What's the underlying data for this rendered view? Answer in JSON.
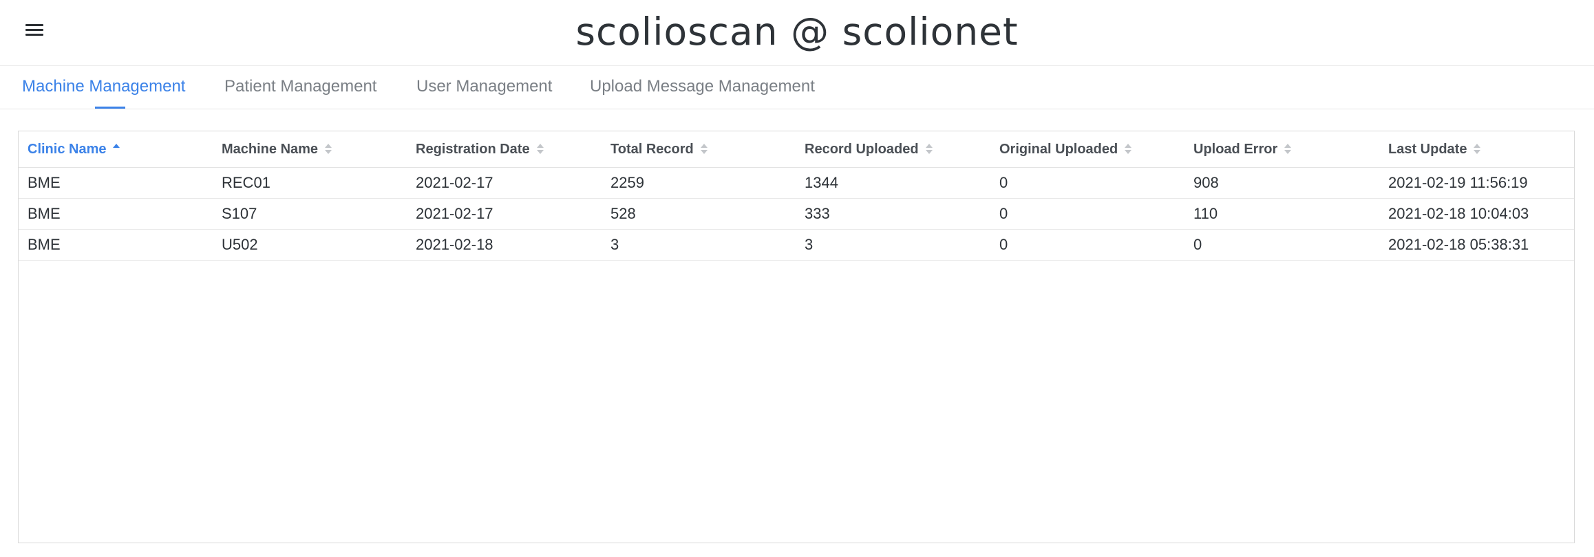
{
  "header": {
    "title": "scolioscan @ scolionet",
    "menu_icon": "hamburger-menu-icon"
  },
  "tabs": [
    {
      "label": "Machine Management",
      "active": true
    },
    {
      "label": "Patient Management",
      "active": false
    },
    {
      "label": "User Management",
      "active": false
    },
    {
      "label": "Upload Message Management",
      "active": false
    }
  ],
  "colors": {
    "accent": "#3b82e8",
    "text": "#2e3338",
    "muted": "#7a7f85"
  },
  "table": {
    "columns": [
      {
        "label": "Clinic Name",
        "sort": "asc"
      },
      {
        "label": "Machine Name",
        "sort": "none"
      },
      {
        "label": "Registration Date",
        "sort": "none"
      },
      {
        "label": "Total Record",
        "sort": "none"
      },
      {
        "label": "Record Uploaded",
        "sort": "none"
      },
      {
        "label": "Original Uploaded",
        "sort": "none"
      },
      {
        "label": "Upload Error",
        "sort": "none"
      },
      {
        "label": "Last Update",
        "sort": "none"
      }
    ],
    "rows": [
      [
        "BME",
        "REC01",
        "2021-02-17",
        "2259",
        "1344",
        "0",
        "908",
        "2021-02-19 11:56:19"
      ],
      [
        "BME",
        "S107",
        "2021-02-17",
        "528",
        "333",
        "0",
        "110",
        "2021-02-18 10:04:03"
      ],
      [
        "BME",
        "U502",
        "2021-02-18",
        "3",
        "3",
        "0",
        "0",
        "2021-02-18 05:38:31"
      ]
    ]
  }
}
